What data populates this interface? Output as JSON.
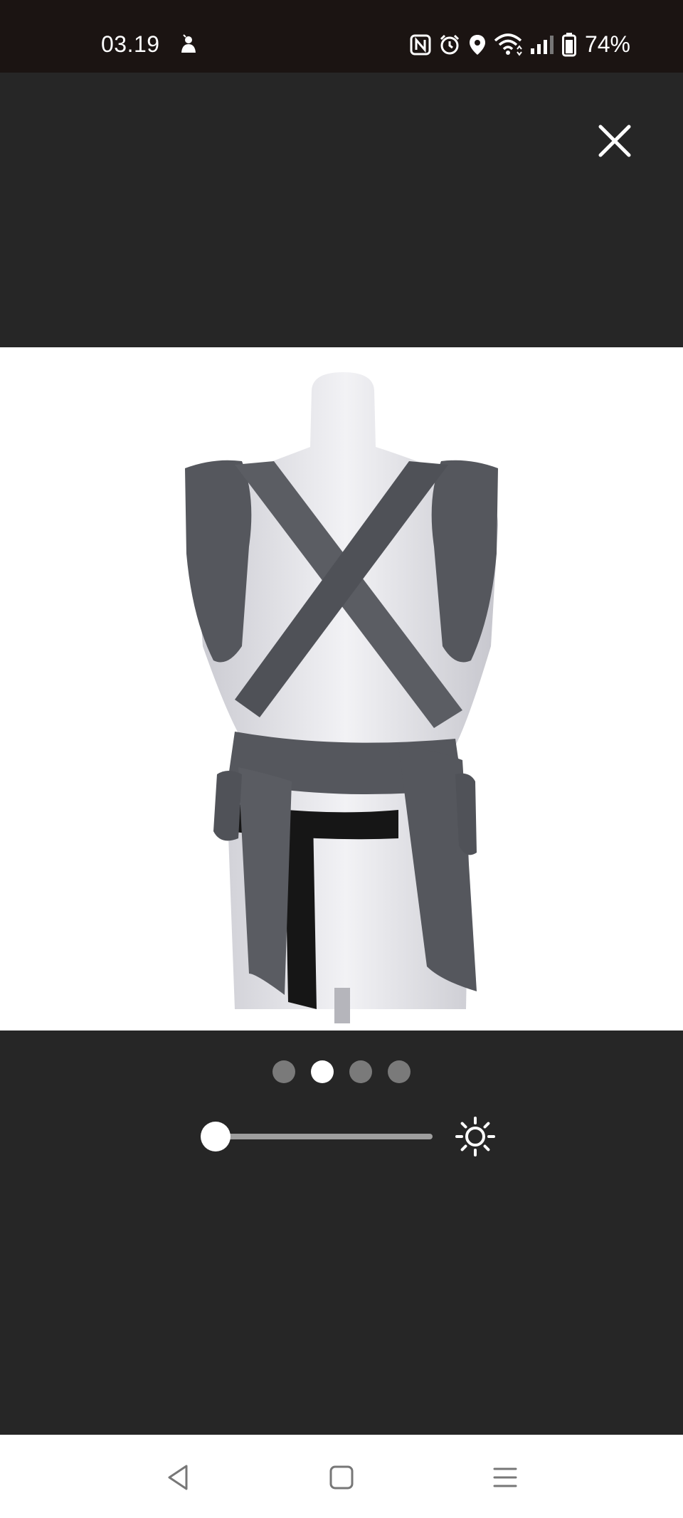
{
  "status_bar": {
    "time": "03.19",
    "battery_percent": "74%",
    "icons": [
      "notification-icon",
      "nfc-icon",
      "alarm-icon",
      "location-icon",
      "wifi-icon",
      "signal-icon",
      "battery-icon"
    ]
  },
  "viewer": {
    "close_icon": "close-icon",
    "image_index": 2,
    "image_count": 4,
    "brightness_level": 0.06,
    "brightness_icon": "sun-icon"
  },
  "nav_bar": {
    "buttons": [
      "back-icon",
      "home-icon",
      "recents-icon"
    ]
  },
  "colors": {
    "status_bar_bg": "#1b1412",
    "viewer_bg": "#262626",
    "photo_bg": "#ffffff",
    "fabric": "#55575d",
    "mannequin": "#e3e3e8"
  }
}
